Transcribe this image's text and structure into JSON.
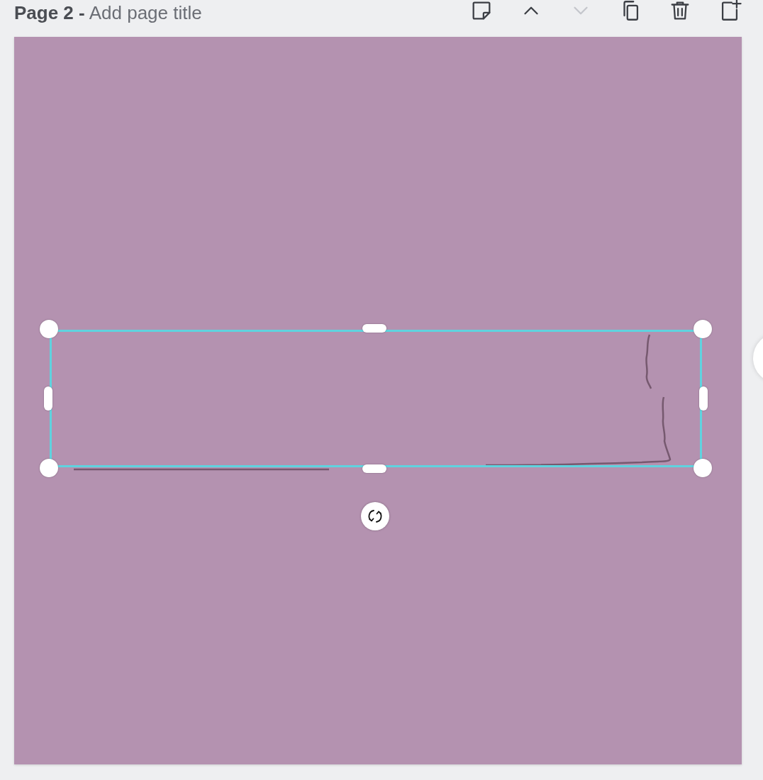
{
  "header": {
    "page_label": "Page 2 -",
    "title_placeholder": "Add page title"
  },
  "toolbar": [
    {
      "kind": "notes",
      "disabled": false
    },
    {
      "kind": "up",
      "disabled": false
    },
    {
      "kind": "down",
      "disabled": true
    },
    {
      "kind": "copy",
      "disabled": false
    },
    {
      "kind": "delete",
      "disabled": false
    },
    {
      "kind": "add",
      "disabled": false
    }
  ],
  "canvas": {
    "color": "#b492b0",
    "selection": {
      "selected": true
    }
  }
}
